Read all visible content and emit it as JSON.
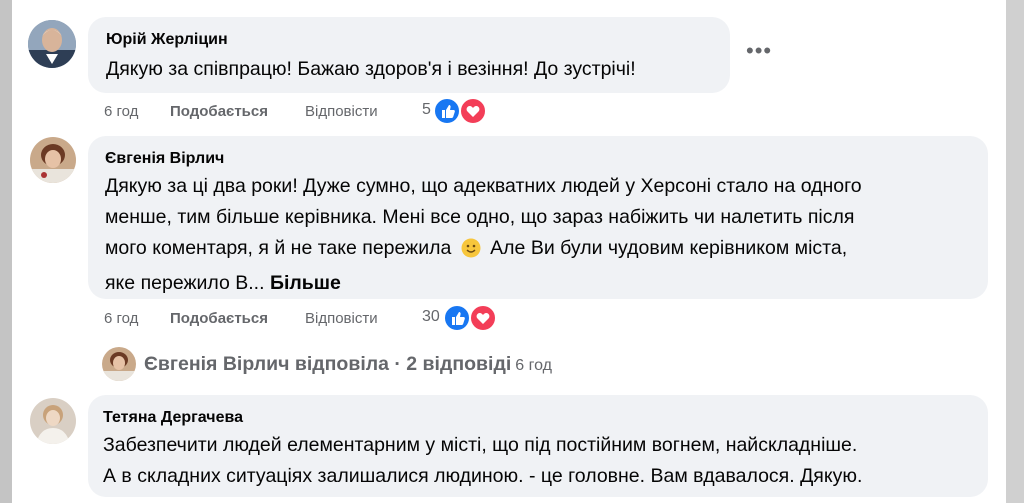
{
  "colors": {
    "like": "#1877f2",
    "love": "#f33e58",
    "bubble": "#f0f2f5",
    "meta": "#65676b"
  },
  "comments": [
    {
      "author": "Юрій Жерліцин",
      "lines": [
        "Дякую за співпрацю! Бажаю здоров'я і везіння! До зустрічі!"
      ],
      "time": "6 год",
      "like_label": "Подобається",
      "reply_label": "Відповісти",
      "reactions": "5",
      "more_icon": "more-options-icon"
    },
    {
      "author": "Євгенія Вірлич",
      "lines": [
        "Дякую за ці два роки! Дуже сумно, що адекватних людей у Херсоні стало на одного",
        "менше, тим більше керівника. Мені все одно, що зараз набіжить чи налетить після",
        "мого коментаря, я й не таке пережила",
        "Але Ви були чудовим керівником міста,",
        "яке пережило В..."
      ],
      "see_more": "Більше",
      "emoji": "slightly-smiling-face",
      "time": "6 год",
      "like_label": "Подобається",
      "reply_label": "Відповісти",
      "reactions": "30",
      "replies": {
        "text": "Євгенія Вірлич відповіла · 2 відповіді",
        "time": "6 год"
      }
    },
    {
      "author": "Тетяна Дергачева",
      "lines": [
        "Забезпечити людей елементарним у місті, що під постійним вогнем, найскладніше.",
        "А в складних ситуаціях залишалися людиною. - це головне. Вам вдавалося. Дякую."
      ]
    }
  ]
}
